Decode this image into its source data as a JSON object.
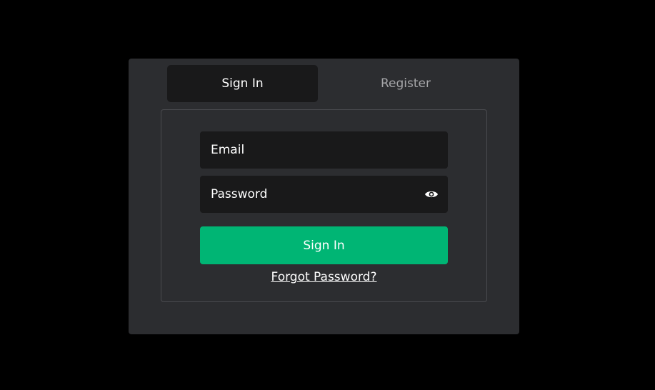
{
  "tabs": {
    "sign_in": "Sign In",
    "register": "Register"
  },
  "form": {
    "email_placeholder": "Email",
    "password_placeholder": "Password",
    "password_toggle_icon": "eye-icon",
    "submit_label": "Sign In",
    "forgot_password": "Forgot Password?"
  },
  "colors": {
    "page_background": "#000000",
    "panel_background": "#2c2d30",
    "input_background": "#19191a",
    "accent": "#00b574",
    "inactive_tab_text": "#a5a5a8"
  }
}
